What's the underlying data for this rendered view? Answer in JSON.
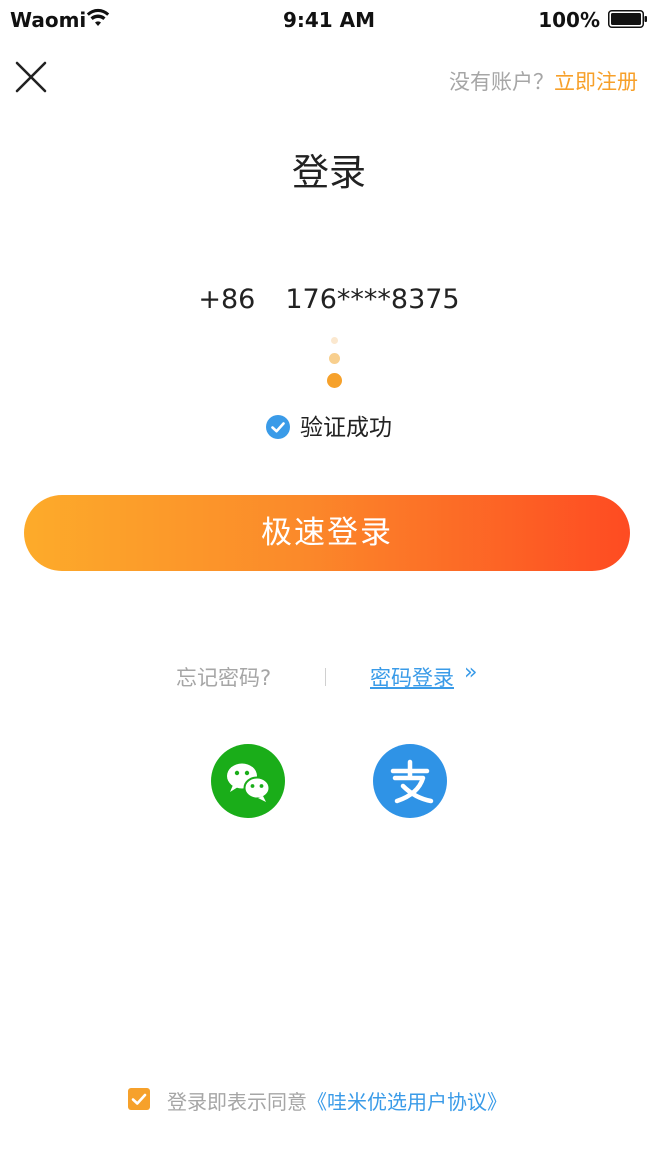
{
  "status_bar": {
    "carrier": "Waomi",
    "time": "9:41 AM",
    "battery": "100%"
  },
  "header": {
    "no_account_text": "没有账户？",
    "register_link": "立即注册"
  },
  "title": "登录",
  "phone": {
    "country_code": "+86",
    "number": "176****8375"
  },
  "verify": {
    "text": "验证成功"
  },
  "login_button": "极速登录",
  "links": {
    "forgot": "忘记密码?",
    "password_login": "密码登录",
    "arrow": "»"
  },
  "social": {
    "wechat_icon": "wechat-icon",
    "alipay_icon": "alipay-icon"
  },
  "agreement": {
    "checked": true,
    "prefix": "登录即表示同意",
    "link": "《哇米优选用户协议》"
  },
  "colors": {
    "accent_orange": "#f6a12b",
    "link_blue": "#3a9be8",
    "wechat_green": "#1aad19",
    "alipay_blue": "#2f93e6"
  }
}
